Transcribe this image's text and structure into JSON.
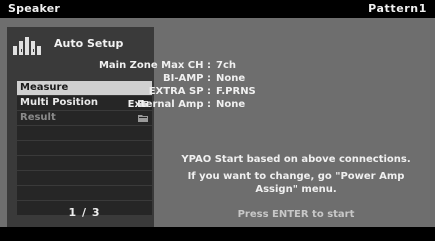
{
  "header": {
    "title": "Speaker",
    "pattern": "Pattern1"
  },
  "sidebar": {
    "heading": "Auto Setup",
    "heading_icon": "speaker-setup-icon",
    "items": [
      {
        "label": "Measure",
        "state": "selected"
      },
      {
        "label": "Multi Position",
        "state": "normal",
        "icon": "folder-icon"
      },
      {
        "label": "Result",
        "state": "disabled",
        "icon": "folder-icon"
      }
    ],
    "page": "1 / 3"
  },
  "connections": [
    {
      "label": "Main Zone Max CH :",
      "value": "7ch"
    },
    {
      "label": "BI-AMP :",
      "value": "None"
    },
    {
      "label": "EXTRA SP :",
      "value": "F.PRNS"
    },
    {
      "label": "External Amp :",
      "value": "None"
    }
  ],
  "message": {
    "line1": "YPAO Start based on above connections.",
    "line2": "If you want to change, go \"Power Amp",
    "line3": "Assign\" menu."
  },
  "prompt": "Press ENTER to start",
  "colors": {
    "screen_bg": "#6e6e6e",
    "panel_bg": "#3a3a3a",
    "row_bg": "#262626",
    "selected_row_bg": "#d0d0d0"
  }
}
